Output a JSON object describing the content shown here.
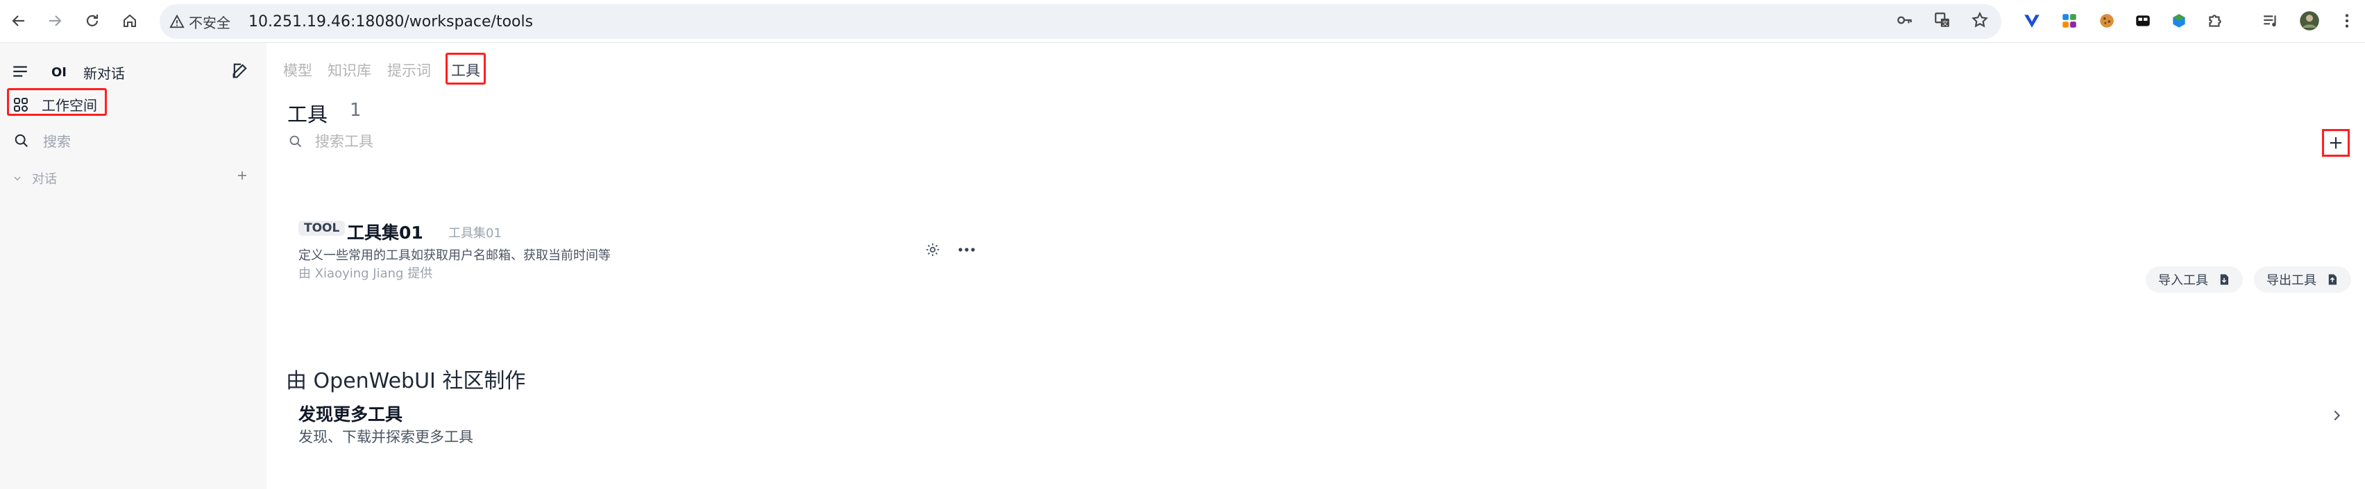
{
  "browser": {
    "security_label": "不安全",
    "url": "10.251.19.46:18080/workspace/tools",
    "icons": [
      "back-icon",
      "forward-icon",
      "reload-icon",
      "home-icon",
      "key-icon",
      "translate-icon",
      "star-icon",
      "extension-icons",
      "profile-avatar",
      "menu-icon"
    ]
  },
  "sidebar": {
    "logo_text": "OI",
    "new_chat_label": "新对话",
    "workspace_label": "工作空间",
    "search_placeholder": "搜索",
    "chats_section_label": "对话"
  },
  "main": {
    "tabs": [
      {
        "label": "模型"
      },
      {
        "label": "知识库"
      },
      {
        "label": "提示词"
      },
      {
        "label": "工具"
      }
    ],
    "active_tab": "工具",
    "title": "工具",
    "count": "1",
    "search_placeholder": "搜索工具",
    "tools": [
      {
        "badge": "TOOL",
        "name": "工具集01",
        "id": "工具集01",
        "description": "定义一些常用的工具如获取用户名邮箱、获取当前时间等",
        "author": "由 Xiaoying Jiang 提供"
      }
    ],
    "import_label": "导入工具",
    "export_label": "导出工具",
    "community_title": "由 OpenWebUI 社区制作",
    "discover_title": "发现更多工具",
    "discover_subtitle": "发现、下载并探索更多工具"
  },
  "colors": {
    "highlight_red": "#ff1f1f",
    "sidebar_bg": "#f7f7f7",
    "omnibox_bg": "#eef1f6"
  }
}
